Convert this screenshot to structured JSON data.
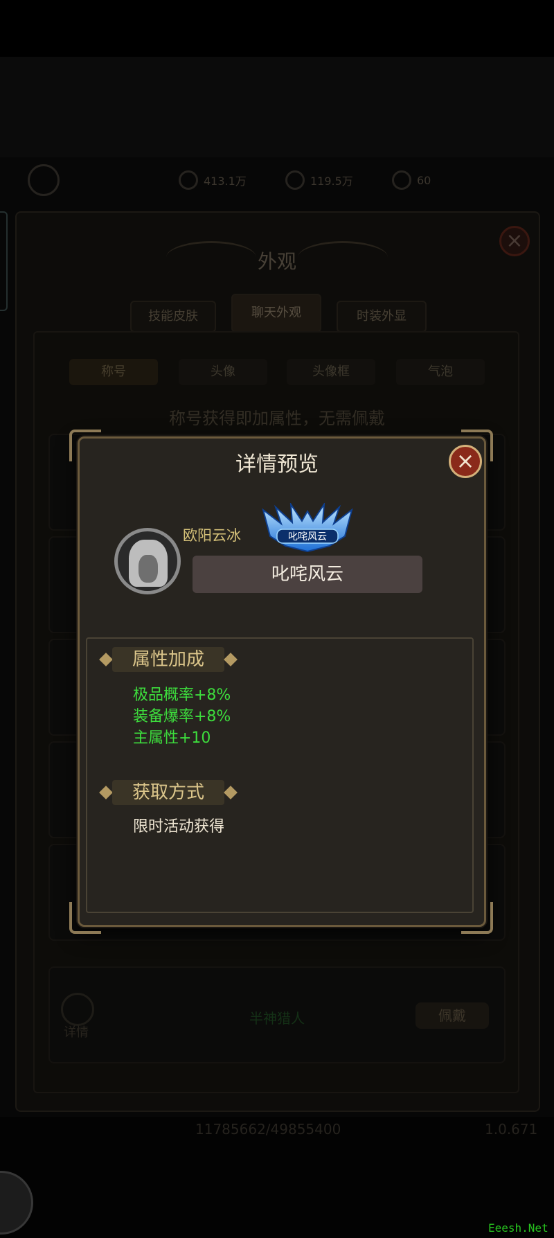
{
  "background": {
    "resources": [
      "413.1万",
      "119.5万",
      "60"
    ],
    "panel_title": "外观",
    "tabs": [
      "技能皮肤",
      "聊天外观",
      "时装外显"
    ],
    "subtabs": [
      "称号",
      "头像",
      "头像框",
      "气泡"
    ],
    "hint": "称号获得即加属性，无需佩戴",
    "row_detail_label": "详情",
    "equip_label": "佩戴",
    "row_title_art": "半神猎人",
    "footer_numbers": [
      "11785662/49855400",
      "1.0.671"
    ]
  },
  "modal": {
    "title": "详情预览",
    "player_name": "欧阳云冰",
    "title_badge_text": "叱咤风云",
    "title_name": "叱咤风云",
    "sections": {
      "attributes": {
        "header": "属性加成",
        "items": [
          "极品概率+8%",
          "装备爆率+8%",
          "主属性+10"
        ]
      },
      "obtain": {
        "header": "获取方式",
        "text": "限时活动获得"
      }
    }
  },
  "watermark": "Eeesh.Net",
  "colors": {
    "attribute_green": "#3ddd3d",
    "name_gold": "#d6c279",
    "close_red": "#8a2a1a"
  },
  "icons": [
    "close-icon",
    "avatar-silhouette",
    "title-badge-wings",
    "magnifier-icon",
    "diamond-ornament"
  ]
}
